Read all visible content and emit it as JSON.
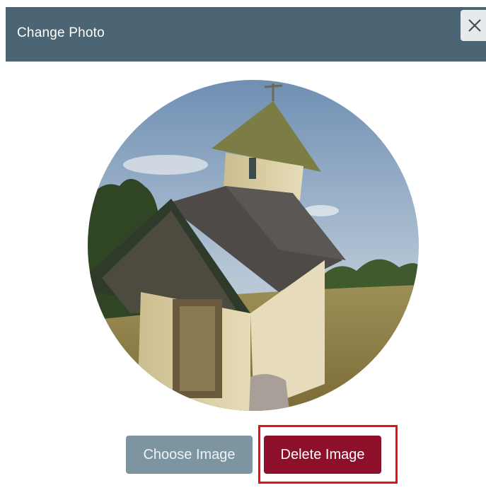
{
  "dialog": {
    "title": "Change Photo",
    "close_icon": "close-icon"
  },
  "photo": {
    "subject": "stone-chapel-photo"
  },
  "actions": {
    "choose_label": "Choose Image",
    "delete_label": "Delete Image"
  },
  "colors": {
    "header_bg": "#4b6575",
    "choose_bg": "#7d95a1",
    "delete_bg": "#8d0f2a",
    "highlight": "#e3111b"
  }
}
